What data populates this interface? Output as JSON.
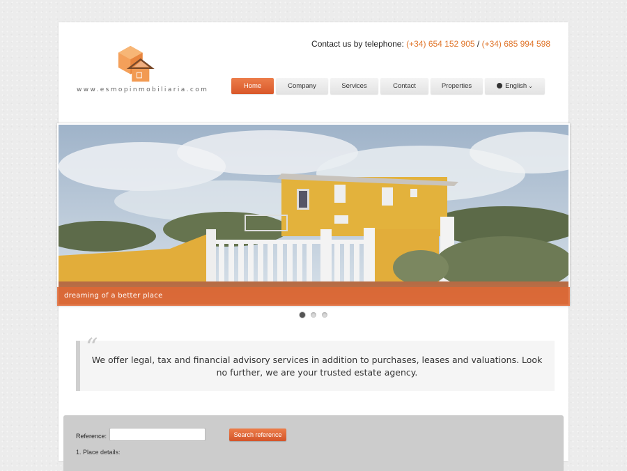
{
  "header": {
    "logo_url_text": "www.esmopinmobiliaria.com",
    "contact_prefix": "Contact us by telephone:",
    "phone_1": "(+34) 654 152 905",
    "separator": " / ",
    "phone_2": "(+34) 685 994 598",
    "accent_color": "#e0762c"
  },
  "nav": {
    "items": [
      {
        "label": "Home",
        "active": true
      },
      {
        "label": "Company",
        "active": false
      },
      {
        "label": "Services",
        "active": false
      },
      {
        "label": "Contact",
        "active": false
      },
      {
        "label": "Properties",
        "active": false
      }
    ],
    "language": {
      "label": "English",
      "icon": "globe-icon",
      "chevron": "chevron-down-icon"
    }
  },
  "slider": {
    "caption": "dreaming of a better place",
    "slide_count": 3,
    "active_index": 0
  },
  "quote": {
    "text": "We offer legal, tax and financial advisory services in addition to purchases, leases and valuations. Look no further, we are your trusted estate agency.",
    "mark": "“"
  },
  "search": {
    "reference_label": "Reference:",
    "reference_value": "",
    "button_label": "Search reference",
    "place_details_label": "1. Place details:"
  }
}
